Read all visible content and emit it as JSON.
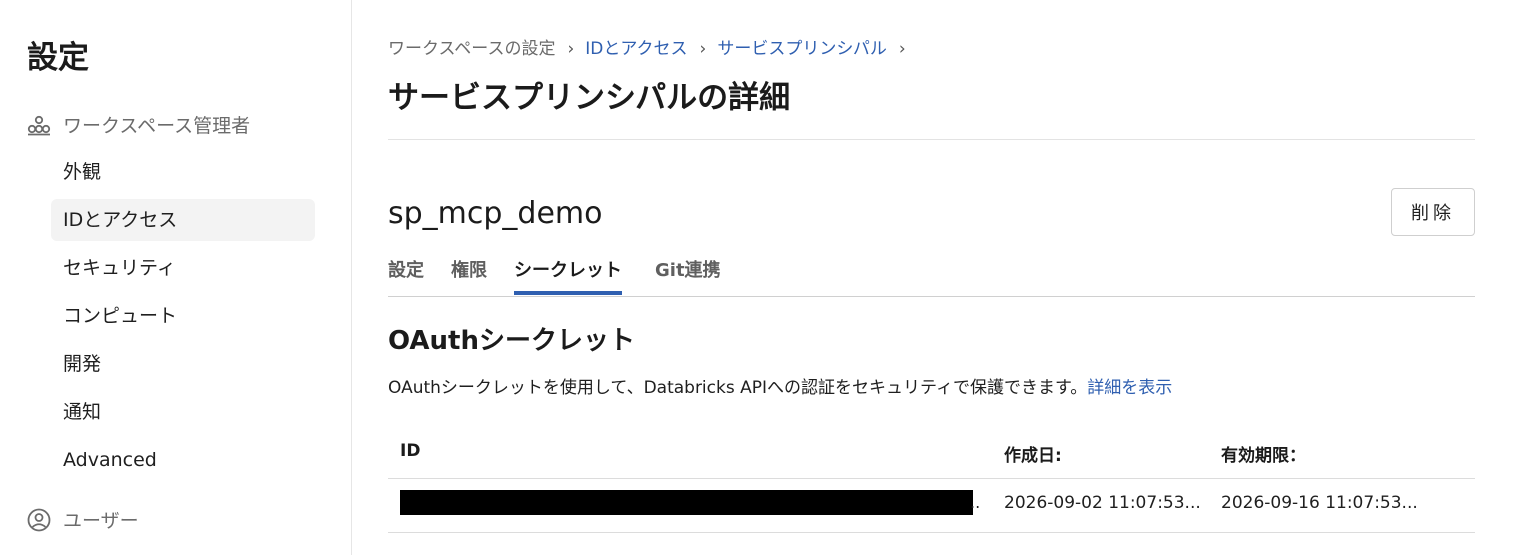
{
  "sidebar": {
    "title": "設定",
    "section1": {
      "label": "ワークスペース管理者",
      "icon": "group-icon"
    },
    "items": [
      {
        "label": "外観"
      },
      {
        "label": "IDとアクセス",
        "active": true
      },
      {
        "label": "セキュリティ"
      },
      {
        "label": "コンピュート"
      },
      {
        "label": "開発"
      },
      {
        "label": "通知"
      },
      {
        "label": "Advanced"
      }
    ],
    "section2": {
      "label": "ユーザー",
      "icon": "user-circle-icon"
    }
  },
  "breadcrumb": {
    "items": [
      "ワークスペースの設定",
      "IDとアクセス",
      "サービスプリンシパル"
    ],
    "separator": "›"
  },
  "page": {
    "title": "サービスプリンシパルの詳細",
    "sp_name": "sp_mcp_demo",
    "delete_label": "削除"
  },
  "tabs": [
    {
      "label": "設定"
    },
    {
      "label": "権限"
    },
    {
      "label": "シークレット",
      "active": true
    },
    {
      "label": "Git連携"
    }
  ],
  "oauth": {
    "title": "OAuthシークレット",
    "description": "OAuthシークレットを使用して、Databricks APIへの認証をセキュリティで保護できます。",
    "link": "詳細を表示"
  },
  "table": {
    "headers": [
      "ID",
      "作成日:",
      "有効期限："
    ],
    "rows": [
      {
        "id": "",
        "id_ellipsis": "..",
        "created": "2026-09-02 11:07:53...",
        "expires": "2026-09-16 11:07:53..."
      }
    ]
  },
  "colors": {
    "accent": "#2f5fb0",
    "active_bg": "#f3f3f3"
  }
}
